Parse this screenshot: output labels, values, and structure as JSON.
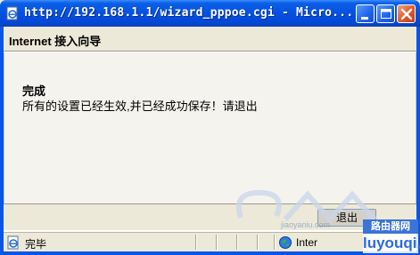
{
  "window": {
    "title": "http://192.168.1.1/wizard_pppoe.cgi - Micro..."
  },
  "header": {
    "title": "Internet 接入向导"
  },
  "message": {
    "heading": "完成",
    "body": "所有的设置已经生效,并已经成功保存！请退出"
  },
  "footer": {
    "button_label": "退出"
  },
  "status": {
    "text": "完毕",
    "zone": "Inter"
  },
  "watermark": {
    "small": "jiaoyaniu.com",
    "brand_top": "路由器网",
    "brand_bottom": "luyouqi.com"
  },
  "colors": {
    "titlebar": "#0551e0",
    "chrome": "#ece9d8",
    "content_bg": "#f4f3ee",
    "close_button": "#e05a2a"
  },
  "icons": {
    "title": "ie-page-icon",
    "minimize": "minimize-icon",
    "maximize": "maximize-icon",
    "close": "close-icon",
    "status": "page-done-icon",
    "zone": "internet-globe-icon"
  }
}
